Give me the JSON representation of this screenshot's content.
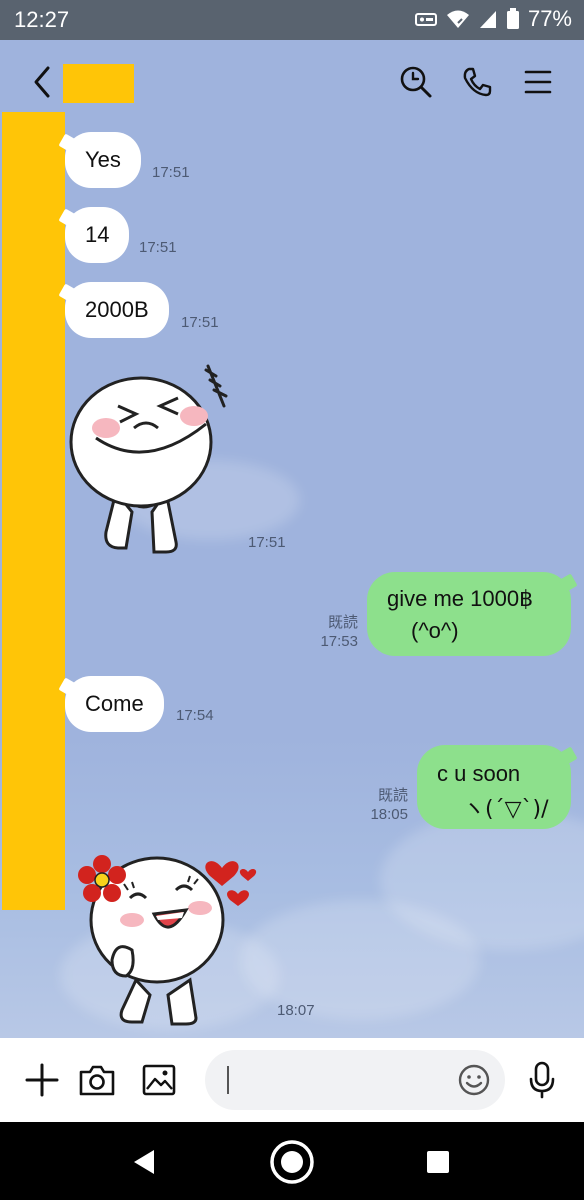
{
  "status": {
    "time": "12:27",
    "battery": "77%"
  },
  "header": {
    "back_icon": "chevron-left-icon",
    "icons": [
      "clock-history-icon",
      "phone-icon",
      "menu-icon"
    ]
  },
  "messages": {
    "m1": {
      "text": "Yes",
      "time": "17:51"
    },
    "m2": {
      "text": "14",
      "time": "17:51"
    },
    "m3": {
      "text": "2000B",
      "time": "17:51"
    },
    "s1": {
      "time": "17:51"
    },
    "o1": {
      "line1": "give me 1000฿",
      "line2": "(^o^)",
      "read": "既読",
      "time": "17:53"
    },
    "m4": {
      "text": "Come",
      "time": "17:54"
    },
    "o2": {
      "line1": "c u soon",
      "line2": "ヽ(´▽`)/",
      "read": "既読",
      "time": "18:05"
    },
    "s2": {
      "time": "18:07"
    }
  },
  "input": {
    "placeholder": "",
    "icons": [
      "plus-icon",
      "camera-icon",
      "image-icon",
      "emoji-icon",
      "microphone-icon"
    ]
  },
  "colors": {
    "chat_bg": "#9fb3dd",
    "outgoing": "#8de08c",
    "incoming": "#ffffff",
    "redaction": "#ffc507"
  }
}
